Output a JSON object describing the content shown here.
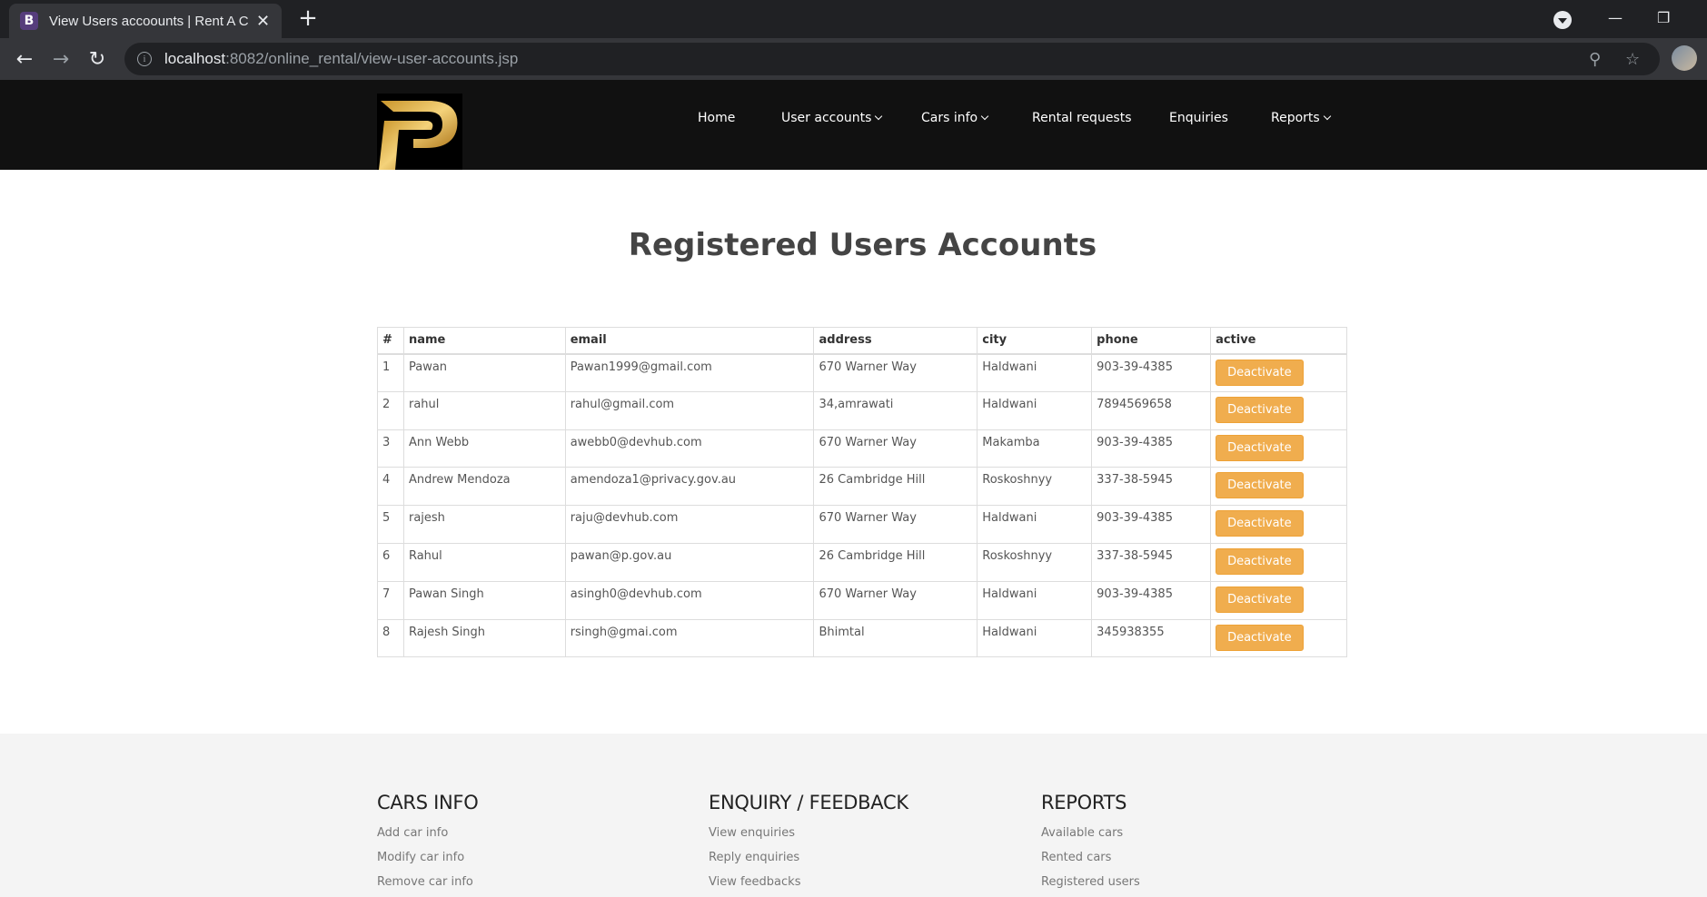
{
  "browser": {
    "tab_icon_letter": "B",
    "tab_title": "View Users accoounts | Rent A Car",
    "tab_close": "✕",
    "new_tab": "+",
    "url_host": "localhost",
    "url_rest": ":8082/online_rental/view-user-accounts.jsp"
  },
  "nav": {
    "items": [
      {
        "label": "Home"
      },
      {
        "label": "User accounts"
      },
      {
        "label": "Cars info"
      },
      {
        "label": "Rental requests"
      },
      {
        "label": "Enquiries"
      },
      {
        "label": "Reports"
      }
    ]
  },
  "main": {
    "title": "Registered Users Accounts",
    "table": {
      "headers": [
        "#",
        "name",
        "email",
        "address",
        "city",
        "phone",
        "active"
      ],
      "rows": [
        {
          "num": "1",
          "name": "Pawan",
          "email": "Pawan1999@gmail.com",
          "address": "670 Warner Way",
          "city": "Haldwani",
          "phone": "903-39-4385",
          "action": "Deactivate"
        },
        {
          "num": "2",
          "name": "rahul",
          "email": "rahul@gmail.com",
          "address": "34,amrawati",
          "city": "Haldwani",
          "phone": "7894569658",
          "action": "Deactivate"
        },
        {
          "num": "3",
          "name": "Ann Webb",
          "email": "awebb0@devhub.com",
          "address": "670 Warner Way",
          "city": "Makamba",
          "phone": "903-39-4385",
          "action": "Deactivate"
        },
        {
          "num": "4",
          "name": "Andrew Mendoza",
          "email": "amendoza1@privacy.gov.au",
          "address": "26 Cambridge Hill",
          "city": "Roskoshnyy",
          "phone": "337-38-5945",
          "action": "Deactivate"
        },
        {
          "num": "5",
          "name": "rajesh",
          "email": "raju@devhub.com",
          "address": "670 Warner Way",
          "city": "Haldwani",
          "phone": "903-39-4385",
          "action": "Deactivate"
        },
        {
          "num": "6",
          "name": "Rahul",
          "email": "pawan@p.gov.au",
          "address": "26 Cambridge Hill",
          "city": "Roskoshnyy",
          "phone": "337-38-5945",
          "action": "Deactivate"
        },
        {
          "num": "7",
          "name": "Pawan Singh",
          "email": "asingh0@devhub.com",
          "address": "670 Warner Way",
          "city": "Haldwani",
          "phone": "903-39-4385",
          "action": "Deactivate"
        },
        {
          "num": "8",
          "name": "Rajesh Singh",
          "email": "rsingh@gmai.com",
          "address": "Bhimtal",
          "city": "Haldwani",
          "phone": "345938355",
          "action": "Deactivate"
        }
      ]
    }
  },
  "footer": {
    "columns": [
      {
        "heading": "CARS INFO",
        "links": [
          "Add car info",
          "Modify car info",
          "Remove car info"
        ]
      },
      {
        "heading": "ENQUIRY / FEEDBACK",
        "links": [
          "View enquiries",
          "Reply enquiries",
          "View feedbacks"
        ]
      },
      {
        "heading": "REPORTS",
        "links": [
          "Available cars",
          "Rented cars",
          "Registered users"
        ]
      }
    ]
  },
  "colors": {
    "header_bg": "#111111",
    "button_warning": "#f0ad4e",
    "footer_bg": "#f4f4f4"
  }
}
